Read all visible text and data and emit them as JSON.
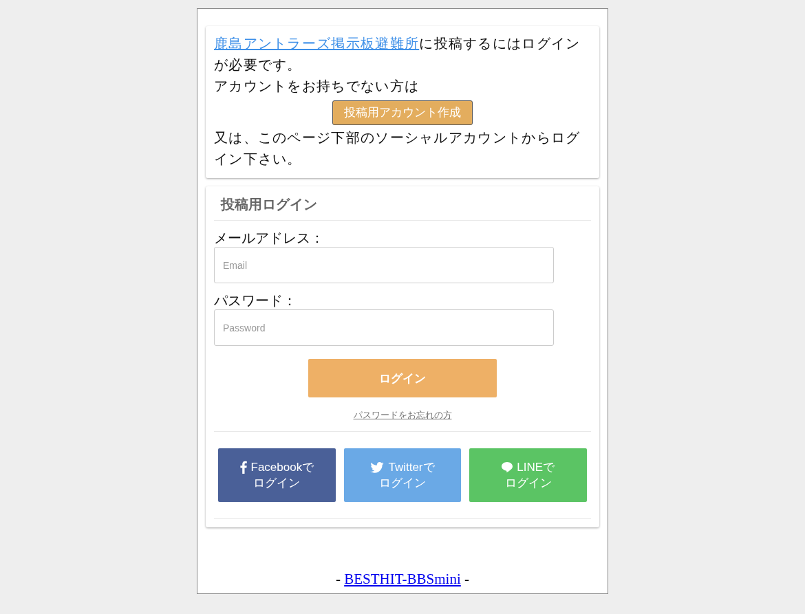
{
  "notice": {
    "link": "鹿島アントラーズ掲示板避難所",
    "text": "に投稿するにはログインが必要です。",
    "no_account": "アカウントをお持ちでない方は",
    "create_button": "投稿用アカウント作成",
    "social_hint": "又は、このページ下部のソーシャルアカウントからログイン下さい。"
  },
  "login": {
    "title": "投稿用ログイン",
    "fields": [
      {
        "label": "メールアドレス：",
        "placeholder": "Email"
      },
      {
        "label": "パスワード：",
        "placeholder": "Password"
      }
    ],
    "submit": "ログイン",
    "forgot": "パスワードをお忘れの方",
    "social": [
      {
        "kind": "facebook",
        "line1": "Facebookで",
        "line2": "ログイン",
        "color": "#4a6098"
      },
      {
        "kind": "twitter",
        "line1": "Twitterで",
        "line2": "ログイン",
        "color": "#6aa9e6"
      },
      {
        "kind": "line",
        "line1": "LINEで",
        "line2": "ログイン",
        "color": "#5bc464"
      }
    ]
  },
  "footer": {
    "before": "-",
    "link": "BESTHIT-BBSmini",
    "after": "-"
  }
}
